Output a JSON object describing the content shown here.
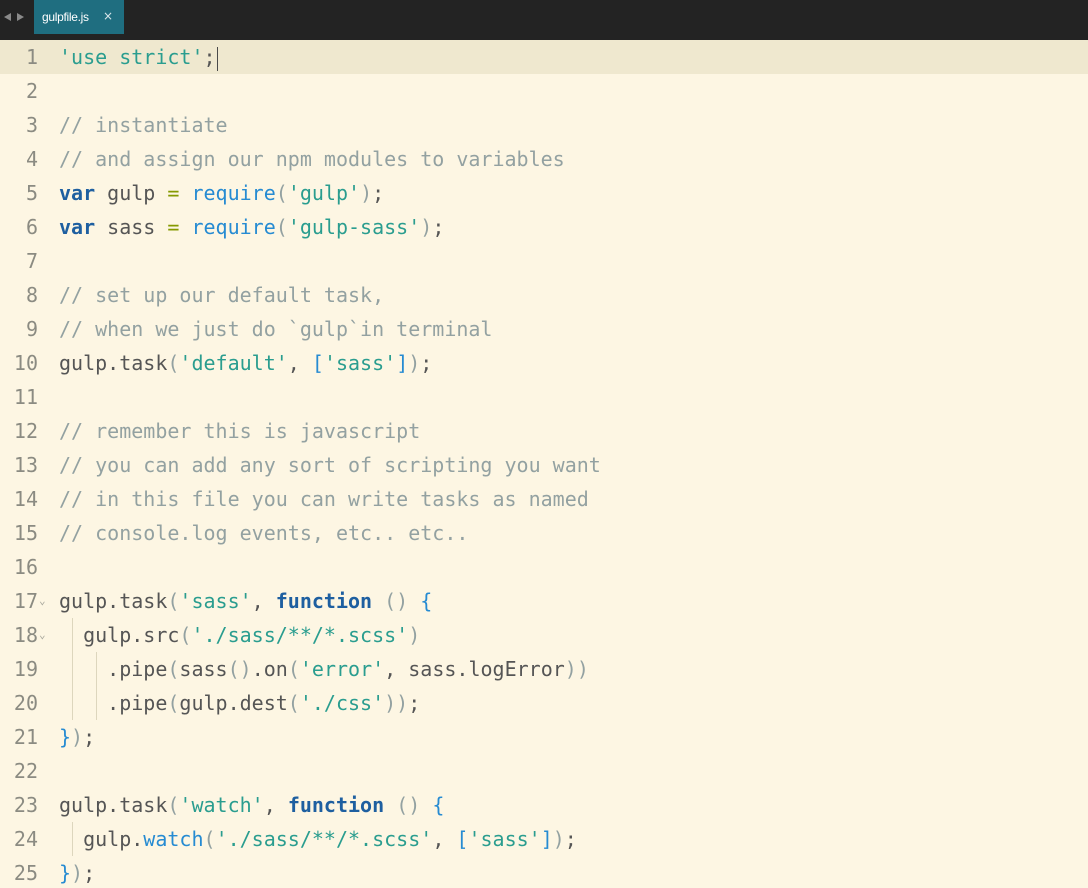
{
  "tab": {
    "filename": "gulpfile.js",
    "close_glyph": "×"
  },
  "colors": {
    "background": "#fdf6e3",
    "tabbar": "#232323",
    "active_tab": "#1f6e80",
    "string": "#2a9d8f",
    "comment": "#93a1a1",
    "keyword": "#1e5fa0",
    "function": "#268bd2",
    "operator": "#859900"
  },
  "editor": {
    "current_line": 1,
    "lines": [
      {
        "n": "1",
        "fold": "",
        "indent": 0,
        "tokens": [
          [
            "str",
            "'use strict'"
          ],
          [
            "pl",
            ";"
          ]
        ]
      },
      {
        "n": "2",
        "fold": "",
        "indent": 0,
        "tokens": []
      },
      {
        "n": "3",
        "fold": "",
        "indent": 0,
        "tokens": [
          [
            "com",
            "// instantiate"
          ]
        ]
      },
      {
        "n": "4",
        "fold": "",
        "indent": 0,
        "tokens": [
          [
            "com",
            "// and assign our npm modules to variables"
          ]
        ]
      },
      {
        "n": "5",
        "fold": "",
        "indent": 0,
        "tokens": [
          [
            "kw",
            "var"
          ],
          [
            "pl",
            " gulp "
          ],
          [
            "op",
            "="
          ],
          [
            "pl",
            " "
          ],
          [
            "fn",
            "require"
          ],
          [
            "mu",
            "("
          ],
          [
            "str",
            "'gulp'"
          ],
          [
            "mu",
            ")"
          ],
          [
            "pl",
            ";"
          ]
        ]
      },
      {
        "n": "6",
        "fold": "",
        "indent": 0,
        "tokens": [
          [
            "kw",
            "var"
          ],
          [
            "pl",
            " sass "
          ],
          [
            "op",
            "="
          ],
          [
            "pl",
            " "
          ],
          [
            "fn",
            "require"
          ],
          [
            "mu",
            "("
          ],
          [
            "str",
            "'gulp-sass'"
          ],
          [
            "mu",
            ")"
          ],
          [
            "pl",
            ";"
          ]
        ]
      },
      {
        "n": "7",
        "fold": "",
        "indent": 0,
        "tokens": []
      },
      {
        "n": "8",
        "fold": "",
        "indent": 0,
        "tokens": [
          [
            "com",
            "// set up our default task,"
          ]
        ]
      },
      {
        "n": "9",
        "fold": "",
        "indent": 0,
        "tokens": [
          [
            "com",
            "// when we just do `gulp`in terminal"
          ]
        ]
      },
      {
        "n": "10",
        "fold": "",
        "indent": 0,
        "tokens": [
          [
            "pl",
            "gulp.task"
          ],
          [
            "mu",
            "("
          ],
          [
            "str",
            "'default'"
          ],
          [
            "pl",
            ", "
          ],
          [
            "br",
            "["
          ],
          [
            "str",
            "'sass'"
          ],
          [
            "br",
            "]"
          ],
          [
            "mu",
            ")"
          ],
          [
            "pl",
            ";"
          ]
        ]
      },
      {
        "n": "11",
        "fold": "",
        "indent": 0,
        "tokens": []
      },
      {
        "n": "12",
        "fold": "",
        "indent": 0,
        "tokens": [
          [
            "com",
            "// remember this is javascript"
          ]
        ]
      },
      {
        "n": "13",
        "fold": "",
        "indent": 0,
        "tokens": [
          [
            "com",
            "// you can add any sort of scripting you want"
          ]
        ]
      },
      {
        "n": "14",
        "fold": "",
        "indent": 0,
        "tokens": [
          [
            "com",
            "// in this file you can write tasks as named"
          ]
        ]
      },
      {
        "n": "15",
        "fold": "",
        "indent": 0,
        "tokens": [
          [
            "com",
            "// console.log events, etc.. etc.."
          ]
        ]
      },
      {
        "n": "16",
        "fold": "",
        "indent": 0,
        "tokens": []
      },
      {
        "n": "17",
        "fold": "⌄",
        "indent": 0,
        "tokens": [
          [
            "pl",
            "gulp.task"
          ],
          [
            "mu",
            "("
          ],
          [
            "str",
            "'sass'"
          ],
          [
            "pl",
            ", "
          ],
          [
            "kw",
            "function"
          ],
          [
            "pl",
            " "
          ],
          [
            "mu",
            "()"
          ],
          [
            "pl",
            " "
          ],
          [
            "br",
            "{"
          ]
        ]
      },
      {
        "n": "18",
        "fold": "⌄",
        "indent": 1,
        "tokens": [
          [
            "pl",
            "  gulp.src"
          ],
          [
            "mu",
            "("
          ],
          [
            "str",
            "'./sass/**/*.scss'"
          ],
          [
            "mu",
            ")"
          ]
        ]
      },
      {
        "n": "19",
        "fold": "",
        "indent": 2,
        "tokens": [
          [
            "pl",
            "    .pipe"
          ],
          [
            "mu",
            "("
          ],
          [
            "pl",
            "sass"
          ],
          [
            "mu",
            "()"
          ],
          [
            "pl",
            ".on"
          ],
          [
            "mu",
            "("
          ],
          [
            "str",
            "'error'"
          ],
          [
            "pl",
            ", sass.logError"
          ],
          [
            "mu",
            "))"
          ]
        ]
      },
      {
        "n": "20",
        "fold": "",
        "indent": 2,
        "tokens": [
          [
            "pl",
            "    .pipe"
          ],
          [
            "mu",
            "("
          ],
          [
            "pl",
            "gulp.dest"
          ],
          [
            "mu",
            "("
          ],
          [
            "str",
            "'./css'"
          ],
          [
            "mu",
            "))"
          ],
          [
            "pl",
            ";"
          ]
        ]
      },
      {
        "n": "21",
        "fold": "",
        "indent": 0,
        "tokens": [
          [
            "br",
            "}"
          ],
          [
            "mu",
            ")"
          ],
          [
            "pl",
            ";"
          ]
        ]
      },
      {
        "n": "22",
        "fold": "",
        "indent": 0,
        "tokens": []
      },
      {
        "n": "23",
        "fold": "",
        "indent": 0,
        "tokens": [
          [
            "pl",
            "gulp.task"
          ],
          [
            "mu",
            "("
          ],
          [
            "str",
            "'watch'"
          ],
          [
            "pl",
            ", "
          ],
          [
            "kw",
            "function"
          ],
          [
            "pl",
            " "
          ],
          [
            "mu",
            "()"
          ],
          [
            "pl",
            " "
          ],
          [
            "br",
            "{"
          ]
        ]
      },
      {
        "n": "24",
        "fold": "",
        "indent": 1,
        "tokens": [
          [
            "pl",
            "  gulp."
          ],
          [
            "fn",
            "watch"
          ],
          [
            "mu",
            "("
          ],
          [
            "str",
            "'./sass/**/*.scss'"
          ],
          [
            "pl",
            ", "
          ],
          [
            "br",
            "["
          ],
          [
            "str",
            "'sass'"
          ],
          [
            "br",
            "]"
          ],
          [
            "mu",
            ")"
          ],
          [
            "pl",
            ";"
          ]
        ]
      },
      {
        "n": "25",
        "fold": "",
        "indent": 0,
        "tokens": [
          [
            "br",
            "}"
          ],
          [
            "mu",
            ")"
          ],
          [
            "pl",
            ";"
          ]
        ]
      }
    ]
  }
}
